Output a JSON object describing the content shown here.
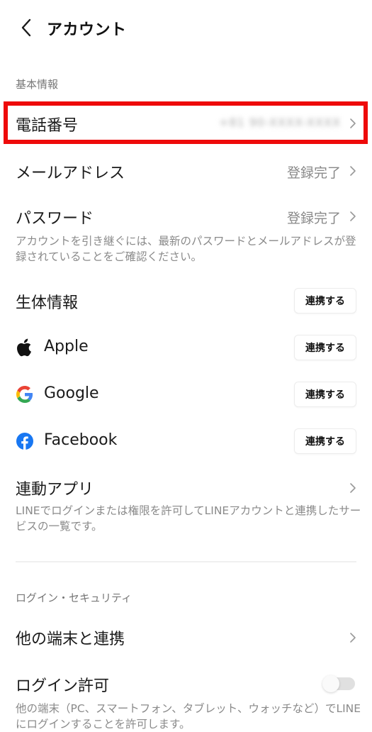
{
  "header": {
    "back_icon": "chevron-left-icon",
    "title": "アカウント"
  },
  "sections": {
    "basic_info_label": "基本情報",
    "login_security_label": "ログイン・セキュリティ"
  },
  "rows": {
    "phone": {
      "label": "電話番号",
      "value": "+81 90-XXXX-XXXX",
      "value_redacted": true,
      "highlighted": true,
      "highlight_color": "#ee0a0a"
    },
    "email": {
      "label": "メールアドレス",
      "value": "登録完了"
    },
    "password": {
      "label": "パスワード",
      "value": "登録完了",
      "description": "アカウントを引き継ぐには、最新のパスワードとメールアドレスが登録されていることをご確認ください。"
    },
    "biometrics": {
      "label": "生体情報",
      "button": "連携する"
    },
    "apple": {
      "label": "Apple",
      "icon": "apple-icon",
      "button": "連携する"
    },
    "google": {
      "label": "Google",
      "icon": "google-icon",
      "button": "連携する"
    },
    "facebook": {
      "label": "Facebook",
      "icon": "facebook-icon",
      "button": "連携する",
      "brand_color": "#1877f2"
    },
    "linked_apps": {
      "label": "連動アプリ",
      "description": "LINEでログインまたは権限を許可してLINEアカウントと連携したサービスの一覧です。"
    },
    "other_devices": {
      "label": "他の端末と連携"
    },
    "login_permission": {
      "label": "ログイン許可",
      "toggle_on": false,
      "description": "他の端末（PC、スマートフォン、タブレット、ウォッチなど）でLINEにログインすることを許可します。"
    }
  }
}
